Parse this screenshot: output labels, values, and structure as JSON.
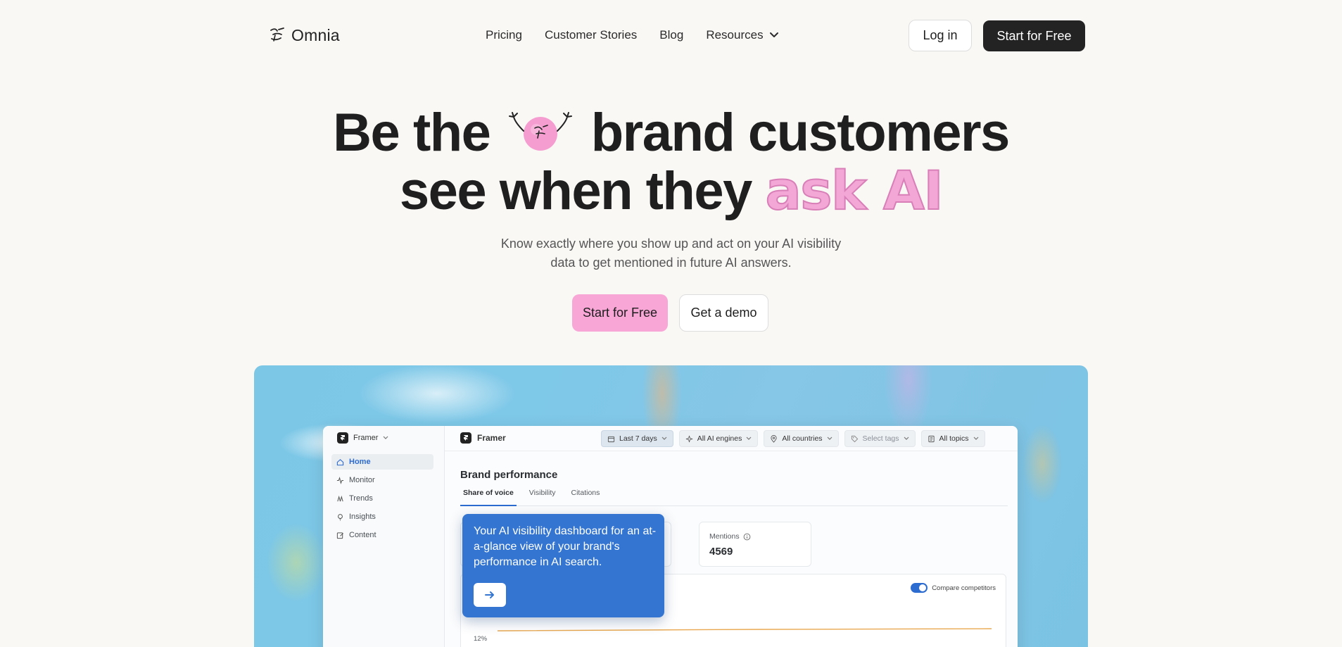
{
  "brand": {
    "name": "Omnia",
    "logo_icon": "omnia-logo-icon"
  },
  "nav": {
    "links": [
      {
        "label": "Pricing"
      },
      {
        "label": "Customer Stories"
      },
      {
        "label": "Blog"
      },
      {
        "label": "Resources",
        "icon": "chevron-down-icon"
      }
    ],
    "login_label": "Log in",
    "start_label": "Start for Free"
  },
  "hero": {
    "line1_a": "Be the",
    "line1_b": "brand customers",
    "line2_a": "see when they",
    "line2_b": "ask AI",
    "subtitle_1": "Know exactly where you show up and act on your AI visibility",
    "subtitle_2": "data to get mentioned in future AI answers.",
    "cta_primary": "Start for Free",
    "cta_secondary": "Get a demo",
    "accent_color": "#f7a6d6"
  },
  "app": {
    "workspace": "Framer",
    "sidebar": [
      {
        "label": "Home",
        "icon": "home-icon",
        "active": true
      },
      {
        "label": "Monitor",
        "icon": "activity-icon"
      },
      {
        "label": "Trends",
        "icon": "trends-icon"
      },
      {
        "label": "Insights",
        "icon": "lightbulb-icon"
      },
      {
        "label": "Content",
        "icon": "edit-icon"
      }
    ],
    "topbar_brand": "Framer",
    "filters": [
      {
        "label": "Last 7 days",
        "icon": "calendar-icon"
      },
      {
        "label": "All AI engines",
        "icon": "sparkle-icon"
      },
      {
        "label": "All countries",
        "icon": "location-icon"
      },
      {
        "label": "Select tags",
        "icon": "tag-icon"
      },
      {
        "label": "All topics",
        "icon": "topics-icon"
      }
    ],
    "section_title": "Brand performance",
    "tabs": [
      "Share of voice",
      "Visibility",
      "Citations"
    ],
    "mentions_label": "Mentions",
    "mentions_value": "4569",
    "compare_label": "Compare competitors",
    "y_tick": "12%",
    "primary_color": "#2c6bd0"
  },
  "tooltip": {
    "text": "Your AI visibility dashboard for an at-a-glance view of your brand's performance in AI search.",
    "button_icon": "arrow-right-icon"
  }
}
